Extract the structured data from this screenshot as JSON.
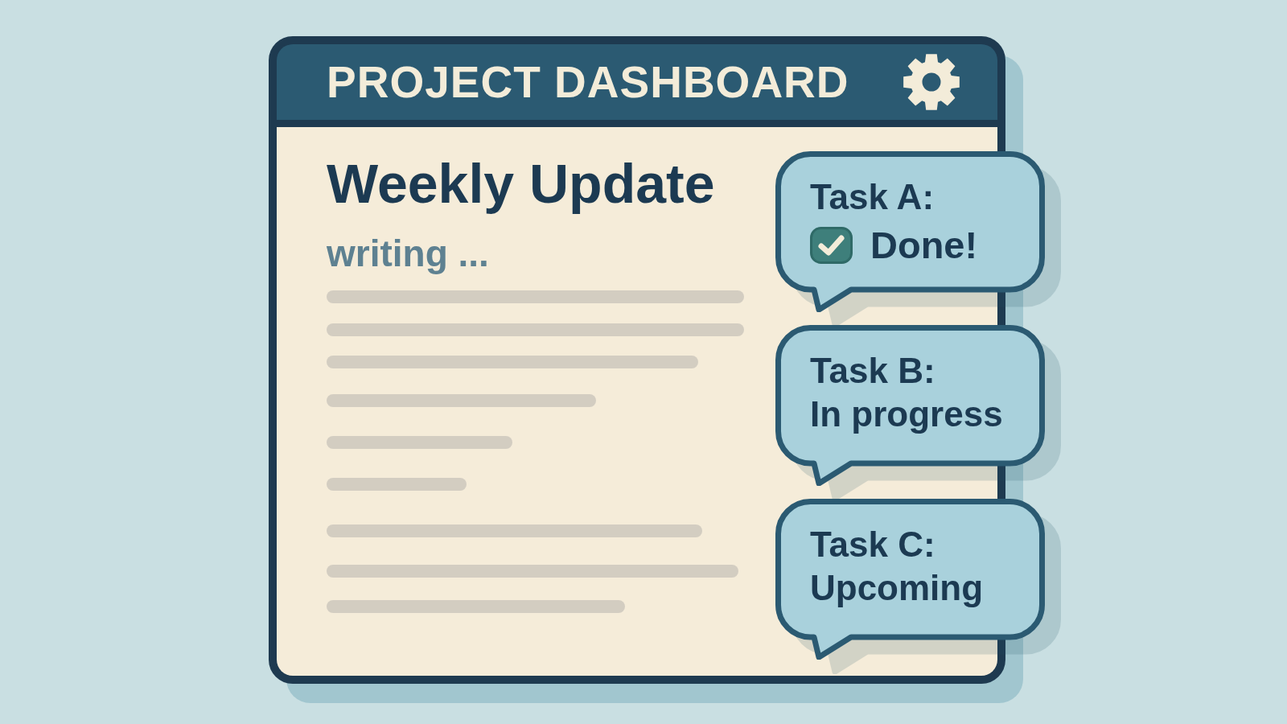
{
  "window": {
    "title": "PROJECT DASHBOARD"
  },
  "document": {
    "heading": "Weekly Update",
    "status": "writing ..."
  },
  "tasks": [
    {
      "label": "Task A:",
      "status": "Done!",
      "done": true
    },
    {
      "label": "Task B:",
      "status": "In progress",
      "done": false
    },
    {
      "label": "Task C:",
      "status": "Upcoming",
      "done": false
    }
  ]
}
